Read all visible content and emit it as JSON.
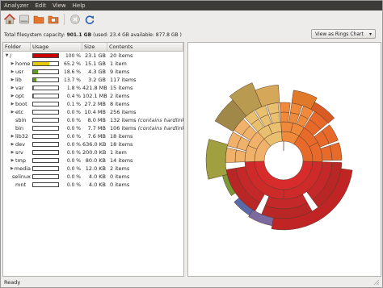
{
  "menu": [
    "Analyzer",
    "Edit",
    "View",
    "Help"
  ],
  "toolbar": {
    "icons": [
      "home-icon",
      "drive-icon",
      "folder-icon",
      "remote-folder-icon",
      "stop-icon",
      "refresh-icon"
    ]
  },
  "info": {
    "prefix": "Total filesystem capacity:",
    "capacity": "901.1 GB",
    "detail": "(used: 23.4 GB available: 877.8 GB )"
  },
  "view_select": {
    "value": "View as Rings Chart"
  },
  "columns": {
    "folder": "Folder",
    "usage": "Usage",
    "size": "Size",
    "contents": "Contents"
  },
  "rows": [
    {
      "name": "/",
      "pct": "100 %",
      "frac": 1.0,
      "color": "#cc0000",
      "size": "23.1 GB",
      "contents": "20 items",
      "expanded": true,
      "indent": 0
    },
    {
      "name": "home",
      "pct": "65.2 %",
      "frac": 0.652,
      "color": "#e8c80a",
      "size": "15.1 GB",
      "contents": "1 item",
      "indent": 1
    },
    {
      "name": "usr",
      "pct": "18.6 %",
      "frac": 0.186,
      "color": "#59a31c",
      "size": "4.3 GB",
      "contents": "9 items",
      "indent": 1
    },
    {
      "name": "lib",
      "pct": "13.7 %",
      "frac": 0.137,
      "color": "#59a31c",
      "size": "3.2 GB",
      "contents": "117 items",
      "indent": 1
    },
    {
      "name": "var",
      "pct": "1.8 %",
      "frac": 0.018,
      "color": "#59a31c",
      "size": "421.8 MB",
      "contents": "15 items",
      "indent": 1
    },
    {
      "name": "opt",
      "pct": "0.4 %",
      "frac": 0.004,
      "color": "#59a31c",
      "size": "102.1 MB",
      "contents": "2 items",
      "indent": 1
    },
    {
      "name": "boot",
      "pct": "0.1 %",
      "frac": 0.001,
      "color": "#59a31c",
      "size": "27.2 MB",
      "contents": "8 items",
      "indent": 1
    },
    {
      "name": "etc",
      "pct": "0.0 %",
      "frac": 0,
      "color": "#59a31c",
      "size": "10.4 MB",
      "contents": "256 items",
      "indent": 1
    },
    {
      "name": "sbin",
      "pct": "0.0 %",
      "frac": 0,
      "color": "#59a31c",
      "size": "8.0 MB",
      "contents": "132 items",
      "note": "(contains hardlinks f",
      "indent": 1,
      "leaf": true
    },
    {
      "name": "bin",
      "pct": "0.0 %",
      "frac": 0,
      "color": "#59a31c",
      "size": "7.7 MB",
      "contents": "106 items",
      "note": "(contains hardlinks f",
      "indent": 1,
      "leaf": true
    },
    {
      "name": "lib32",
      "pct": "0.0 %",
      "frac": 0,
      "color": "#59a31c",
      "size": "7.6 MB",
      "contents": "18 items",
      "indent": 1
    },
    {
      "name": "dev",
      "pct": "0.0 %",
      "frac": 0,
      "color": "#59a31c",
      "size": "636.0 KB",
      "contents": "18 items",
      "indent": 1
    },
    {
      "name": "srv",
      "pct": "0.0 %",
      "frac": 0,
      "color": "#59a31c",
      "size": "200.0 KB",
      "contents": "1 item",
      "indent": 1
    },
    {
      "name": "tmp",
      "pct": "0.0 %",
      "frac": 0,
      "color": "#59a31c",
      "size": "80.0 KB",
      "contents": "14 items",
      "indent": 1
    },
    {
      "name": "media",
      "pct": "0.0 %",
      "frac": 0,
      "color": "#59a31c",
      "size": "12.0 KB",
      "contents": "2 items",
      "indent": 1
    },
    {
      "name": "selinux",
      "pct": "0.0 %",
      "frac": 0,
      "color": "#59a31c",
      "size": "4.0 KB",
      "contents": "0 items",
      "indent": 1,
      "leaf": true
    },
    {
      "name": "mnt",
      "pct": "0.0 %",
      "frac": 0,
      "color": "#59a31c",
      "size": "4.0 KB",
      "contents": "0 items",
      "indent": 1,
      "leaf": true
    }
  ],
  "status": "Ready"
}
